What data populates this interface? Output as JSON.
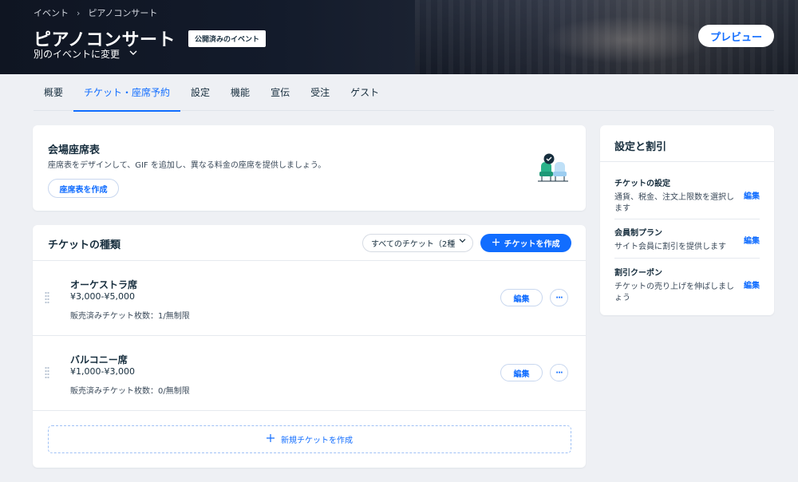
{
  "header": {
    "breadcrumb": [
      "イベント",
      "ピアノコンサート"
    ],
    "title": "ピアノコンサート",
    "status_badge": "公開済みのイベント",
    "switch_event": "別のイベントに変更",
    "preview": "プレビュー"
  },
  "tabs": [
    {
      "label": "概要",
      "active": false
    },
    {
      "label": "チケット・座席予約",
      "active": true
    },
    {
      "label": "設定",
      "active": false
    },
    {
      "label": "機能",
      "active": false
    },
    {
      "label": "宣伝",
      "active": false
    },
    {
      "label": "受注",
      "active": false
    },
    {
      "label": "ゲスト",
      "active": false
    }
  ],
  "seating": {
    "title": "会場座席表",
    "description": "座席表をデザインして、GIF を追加し、異なる料金の座席を提供しましょう。",
    "button": "座席表を作成"
  },
  "tickets": {
    "title": "チケットの種類",
    "filter": "すべてのチケット（2種",
    "create_button": "チケットを作成",
    "items": [
      {
        "name": "オーケストラ席",
        "price": "¥3,000-¥5,000",
        "sold": "販売済みチケット枚数：1/無制限",
        "edit": "編集",
        "more": "···"
      },
      {
        "name": "バルコニー席",
        "price": "¥1,000-¥3,000",
        "sold": "販売済みチケット枚数：0/無制限",
        "edit": "編集",
        "more": "···"
      }
    ],
    "new_ticket": "新規チケットを作成"
  },
  "settings": {
    "title": "設定と割引",
    "items": [
      {
        "title": "チケットの設定",
        "description": "通貨、税金、注文上限数を選択します",
        "action": "編集"
      },
      {
        "title": "会員制プラン",
        "description": "サイト会員に割引を提供します",
        "action": "編集"
      },
      {
        "title": "割引クーポン",
        "description": "チケットの売り上げを伸ばしましょう",
        "action": "編集"
      }
    ]
  },
  "colors": {
    "accent": "#116dff",
    "text": "#162d3d",
    "background": "#eef0f4",
    "seat_green": "#2bb38a",
    "seat_blue": "#bfe0f7"
  }
}
